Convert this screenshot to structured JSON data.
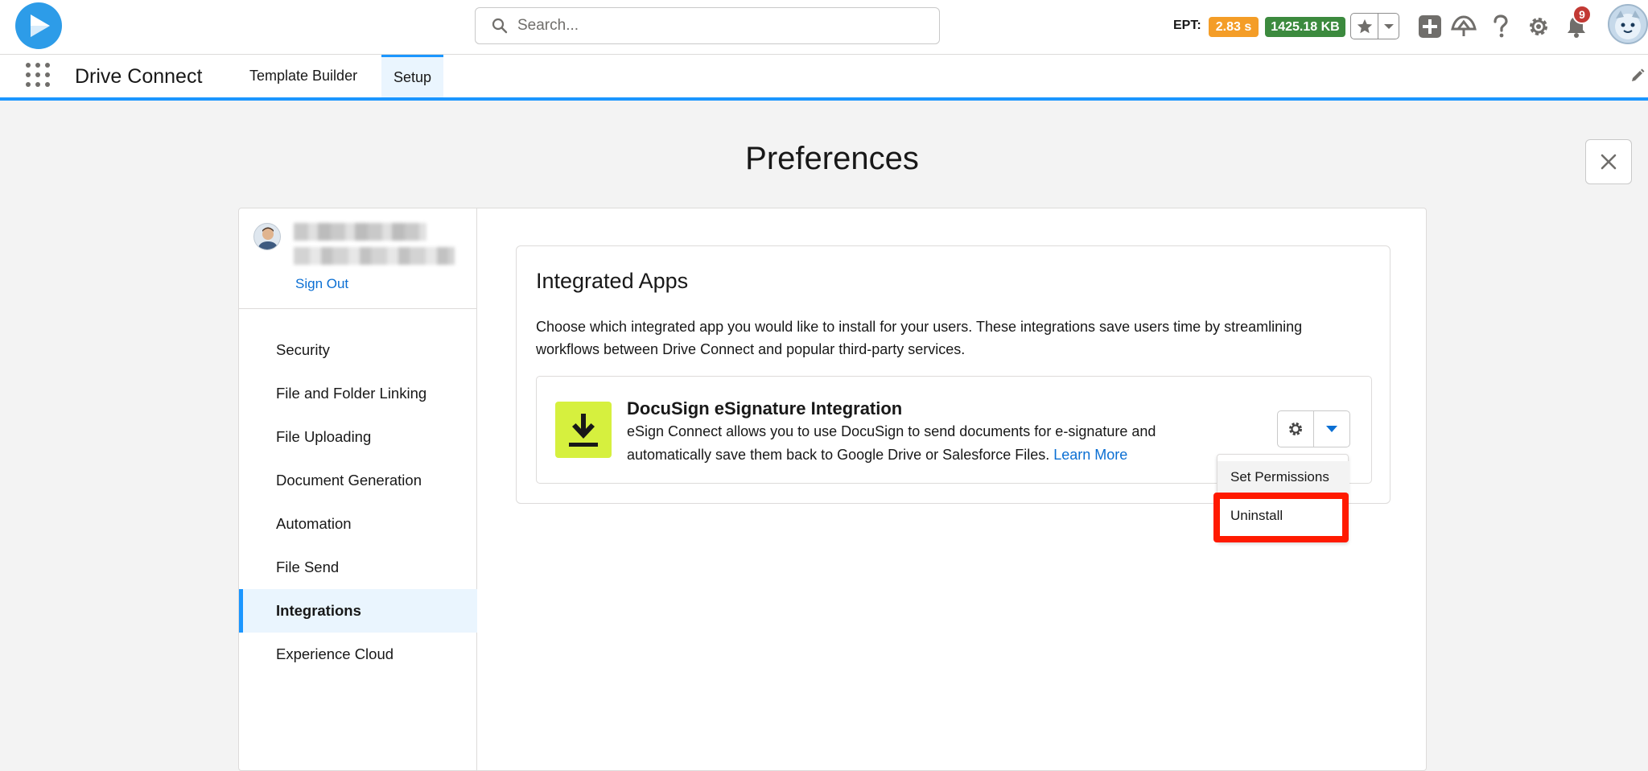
{
  "header": {
    "search_placeholder": "Search...",
    "ept_label": "EPT:",
    "ept_time": "2.83 s",
    "ept_size": "1425.18 KB",
    "notification_count": "9"
  },
  "nav": {
    "app_name": "Drive Connect",
    "tabs": [
      {
        "label": "Template Builder"
      },
      {
        "label": "Setup"
      }
    ]
  },
  "page": {
    "title": "Preferences"
  },
  "sidebar": {
    "sign_out": "Sign Out",
    "items": [
      {
        "label": "Security"
      },
      {
        "label": "File and Folder Linking"
      },
      {
        "label": "File Uploading"
      },
      {
        "label": "Document Generation"
      },
      {
        "label": "Automation"
      },
      {
        "label": "File Send"
      },
      {
        "label": "Integrations"
      },
      {
        "label": "Experience Cloud"
      }
    ]
  },
  "integrations": {
    "title": "Integrated Apps",
    "description": "Choose which integrated app you would like to install for your users. These integrations save users time by streamlining workflows between Drive Connect and popular third-party services.",
    "app": {
      "name": "DocuSign eSignature Integration",
      "description": "eSign Connect allows you to use DocuSign to send documents for e-signature and automatically save them back to Google Drive or Salesforce Files.",
      "learn_more": "Learn More"
    },
    "menu": {
      "set_permissions": "Set Permissions",
      "uninstall": "Uninstall"
    }
  },
  "colors": {
    "brand_blue": "#1b96ff",
    "link_blue": "#0b6fd3",
    "ept_time_badge": "#f49d27",
    "ept_size_badge": "#3c8a3e",
    "app_icon_bg": "#d6f03e",
    "highlight_red": "#ff1a00"
  }
}
